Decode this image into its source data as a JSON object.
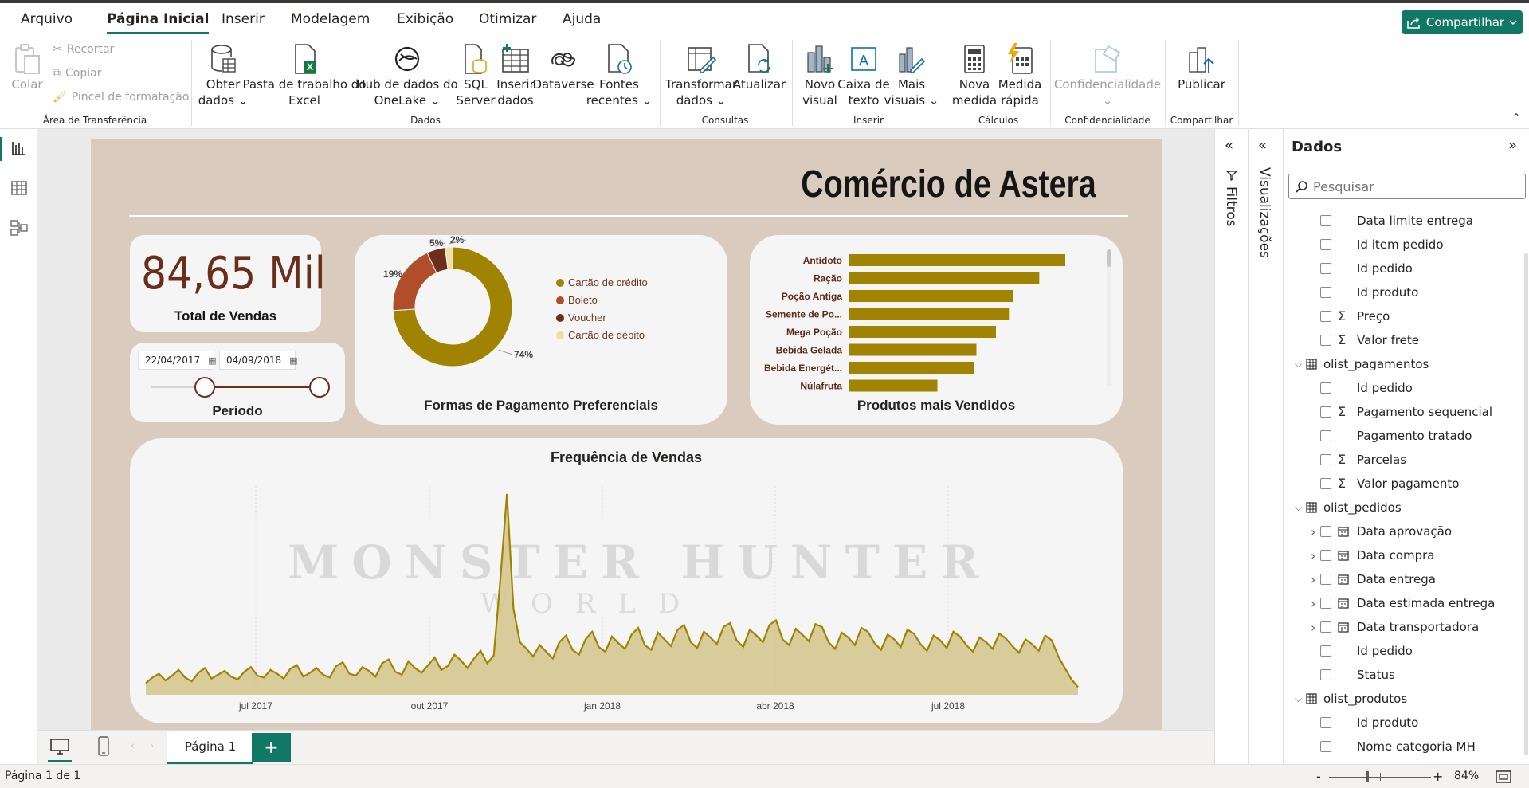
{
  "menu": {
    "tabs": [
      "Arquivo",
      "Página Inicial",
      "Inserir",
      "Modelagem",
      "Exibição",
      "Otimizar",
      "Ajuda"
    ],
    "active_tab": "Página Inicial",
    "share_label": "Compartilhar"
  },
  "ribbon": {
    "clipboard": {
      "paste": "Colar",
      "cut": "Recortar",
      "copy": "Copiar",
      "format_painter": "Pincel de formatação",
      "group": "Área de Transferência"
    },
    "data": {
      "get_data_1": "Obter",
      "get_data_2": "dados",
      "excel_1": "Pasta de trabalho do",
      "excel_2": "Excel",
      "onelake_1": "Hub de dados do",
      "onelake_2": "OneLake",
      "sql_1": "SQL",
      "sql_2": "Server",
      "enter_1": "Inserir",
      "enter_2": "dados",
      "dataverse": "Dataverse",
      "recent_1": "Fontes",
      "recent_2": "recentes",
      "group": "Dados"
    },
    "queries": {
      "transform_1": "Transformar",
      "transform_2": "dados",
      "refresh": "Atualizar",
      "group": "Consultas"
    },
    "insert": {
      "new_visual_1": "Novo",
      "new_visual_2": "visual",
      "textbox_1": "Caixa de",
      "textbox_2": "texto",
      "more_1": "Mais",
      "more_2": "visuais",
      "group": "Inserir"
    },
    "calc": {
      "measure_1": "Nova",
      "measure_2": "medida",
      "quick_1": "Medida",
      "quick_2": "rápida",
      "group": "Cálculos"
    },
    "sensitivity": {
      "label": "Confidencialidade",
      "group": "Confidencialidade"
    },
    "share": {
      "publish": "Publicar",
      "group": "Compartilhar"
    }
  },
  "report": {
    "title": "Comércio de Astera",
    "kpi": {
      "value": "84,65 Mil",
      "label": "Total de Vendas"
    },
    "slicer": {
      "start": "22/04/2017",
      "end": "04/09/2018",
      "label": "Período"
    },
    "watermark": {
      "line1": "MONSTER HUNTER",
      "line2": "WORLD"
    }
  },
  "chart_data": [
    {
      "type": "pie",
      "title": "Formas de Pagamento Preferenciais",
      "legend_position": "right",
      "categories": [
        "Cartão de crédito",
        "Boleto",
        "Voucher",
        "Cartão de débito"
      ],
      "values": [
        74,
        19,
        5,
        2
      ],
      "value_labels": [
        "74%",
        "19%",
        "5%",
        "2%"
      ],
      "colors": [
        "#a08300",
        "#b04e2b",
        "#6d2e1b",
        "#f0dfa0"
      ]
    },
    {
      "type": "bar",
      "orientation": "horizontal",
      "title": "Produtos mais Vendidos",
      "categories": [
        "Antídoto",
        "Ração",
        "Poção Antiga",
        "Semente de Po...",
        "Mega Poção",
        "Bebida Gelada",
        "Bebida Energét...",
        "Núlafruta"
      ],
      "values": [
        100,
        88,
        76,
        74,
        68,
        59,
        58,
        41
      ],
      "color": "#a08300"
    },
    {
      "type": "area",
      "title": "Frequência de Vendas",
      "xlabels": [
        "jul 2017",
        "out 2017",
        "jan 2018",
        "abr 2018",
        "jul 2018"
      ],
      "color": "#a08300",
      "fill": "#d2c48a",
      "grid": true,
      "y_profile": [
        12,
        18,
        22,
        15,
        20,
        26,
        18,
        14,
        23,
        28,
        17,
        21,
        25,
        19,
        16,
        24,
        29,
        20,
        18,
        26,
        22,
        17,
        27,
        31,
        19,
        23,
        28,
        21,
        18,
        30,
        34,
        22,
        20,
        29,
        25,
        19,
        33,
        37,
        24,
        21,
        35,
        28,
        23,
        31,
        39,
        26,
        30,
        42,
        36,
        28,
        38,
        46,
        33,
        41,
        120,
        210,
        90,
        55,
        48,
        40,
        52,
        45,
        38,
        55,
        62,
        47,
        42,
        58,
        66,
        50,
        45,
        61,
        54,
        48,
        63,
        70,
        52,
        47,
        65,
        58,
        51,
        68,
        73,
        55,
        49,
        66,
        60,
        53,
        71,
        75,
        57,
        50,
        68,
        62,
        55,
        73,
        78,
        58,
        52,
        69,
        63,
        56,
        74,
        71,
        55,
        48,
        65,
        60,
        52,
        70,
        66,
        54,
        47,
        63,
        58,
        50,
        68,
        64,
        53,
        46,
        62,
        57,
        49,
        66,
        61,
        52,
        45,
        60,
        55,
        48,
        64,
        59,
        51,
        44,
        58,
        53,
        46,
        62,
        57,
        40,
        28,
        16,
        8
      ]
    }
  ],
  "pages": {
    "tab": "Página 1",
    "add": "+"
  },
  "status": {
    "page": "Página 1 de 1",
    "zoom": "84%",
    "zoom_minus": "-",
    "zoom_plus": "+"
  },
  "panes": {
    "filters": "Filtros",
    "visuals": "Visualizações",
    "data_title": "Dados",
    "search_placeholder": "Pesquisar"
  },
  "fields": [
    {
      "label": "Data limite entrega",
      "kind": "field"
    },
    {
      "label": "Id item pedido",
      "kind": "field"
    },
    {
      "label": "Id pedido",
      "kind": "field"
    },
    {
      "label": "Id produto",
      "kind": "field"
    },
    {
      "label": "Preço",
      "kind": "sum"
    },
    {
      "label": "Valor frete",
      "kind": "sum"
    },
    {
      "label": "olist_pagamentos",
      "kind": "table"
    },
    {
      "label": "Id pedido",
      "kind": "field"
    },
    {
      "label": "Pagamento sequencial",
      "kind": "sum"
    },
    {
      "label": "Pagamento tratado",
      "kind": "field"
    },
    {
      "label": "Parcelas",
      "kind": "sum"
    },
    {
      "label": "Valor pagamento",
      "kind": "sum"
    },
    {
      "label": "olist_pedidos",
      "kind": "table"
    },
    {
      "label": "Data aprovação",
      "kind": "date"
    },
    {
      "label": "Data compra",
      "kind": "date"
    },
    {
      "label": "Data entrega",
      "kind": "date"
    },
    {
      "label": "Data estimada entrega",
      "kind": "date"
    },
    {
      "label": "Data transportadora",
      "kind": "date"
    },
    {
      "label": "Id pedido",
      "kind": "field"
    },
    {
      "label": "Status",
      "kind": "field"
    },
    {
      "label": "olist_produtos",
      "kind": "table"
    },
    {
      "label": "Id produto",
      "kind": "field"
    },
    {
      "label": "Nome categoria MH",
      "kind": "field"
    }
  ]
}
